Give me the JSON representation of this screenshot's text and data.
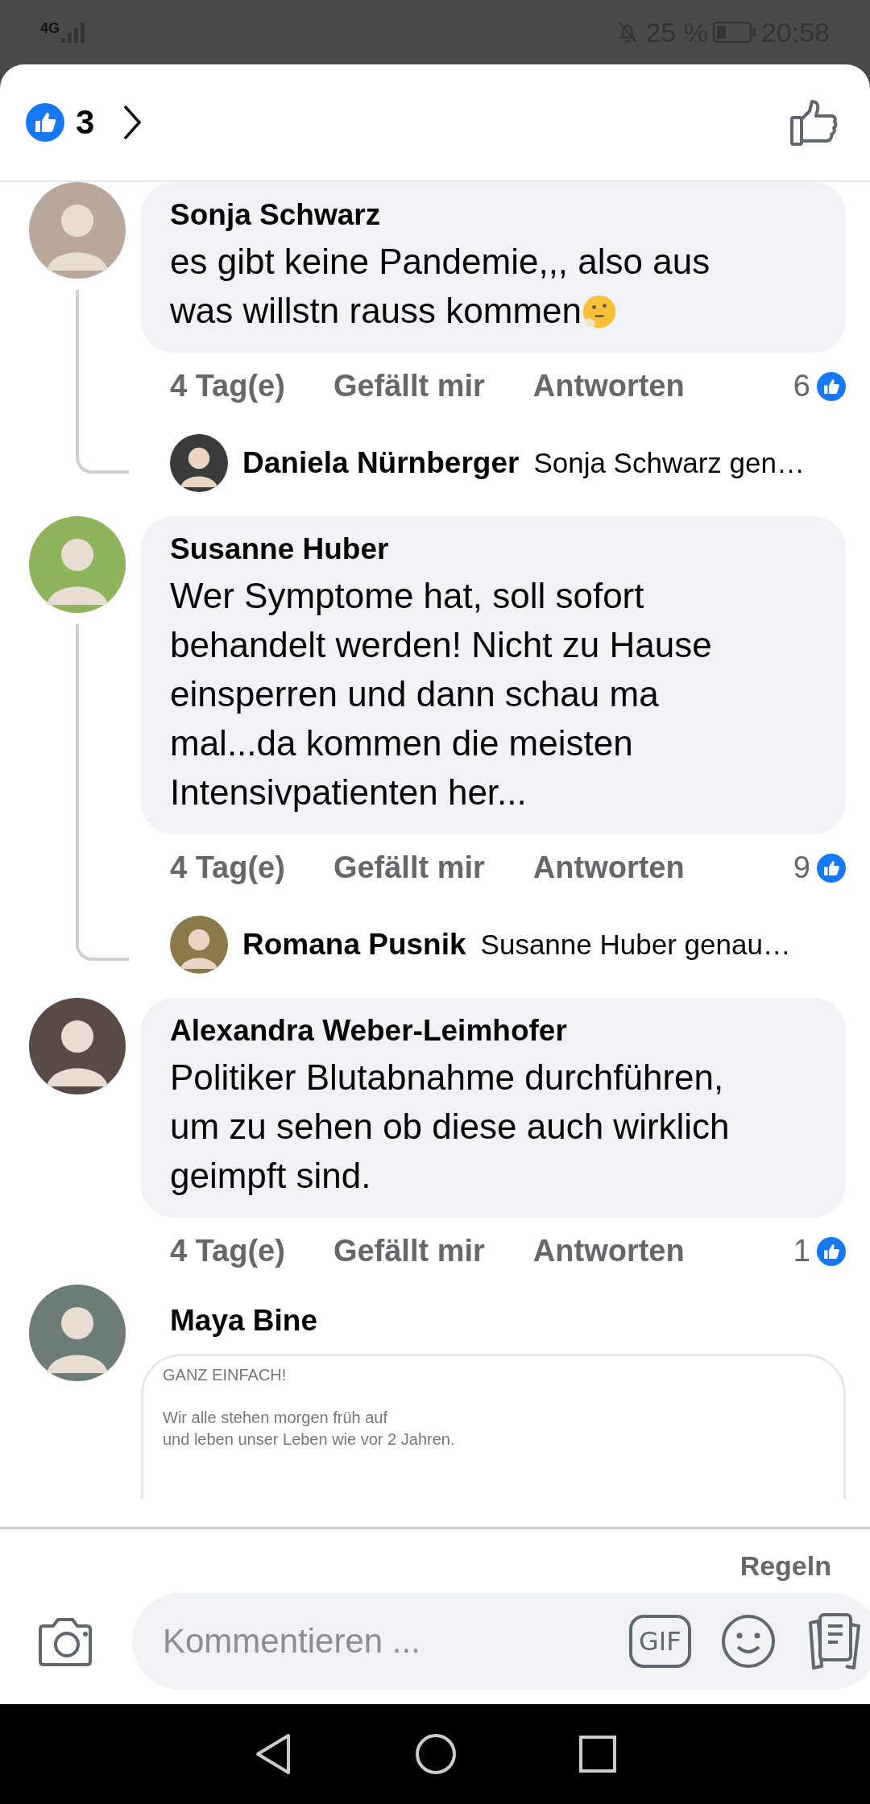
{
  "status_bar": {
    "network": "4G",
    "battery": "25 %",
    "time": "20:58"
  },
  "header": {
    "reaction_count": "3"
  },
  "comments": [
    {
      "name": "Sonja Schwarz",
      "text": "es gibt keine Pandemie,,, also aus was willstn rauss kommen",
      "time": "4 Tag(e)",
      "like_label": "Gefällt mir",
      "reply_label": "Antworten",
      "likes": "6",
      "reply": {
        "name": "Daniela Nürnberger",
        "text": "Sonja Schwarz gen…"
      }
    },
    {
      "name": "Susanne Huber",
      "text": "Wer Symptome hat, soll sofort behandelt werden! Nicht zu Hause einsperren und dann schau ma mal...da kommen die meisten Intensivpatienten her...",
      "time": "4 Tag(e)",
      "like_label": "Gefällt mir",
      "reply_label": "Antworten",
      "likes": "9",
      "reply": {
        "name": "Romana Pusnik",
        "text": "Susanne Huber genau…"
      }
    },
    {
      "name": "Alexandra Weber-Leimhofer",
      "text": "Politiker Blutabnahme durchführen, um zu sehen ob diese auch wirklich geimpft sind.",
      "time": "4 Tag(e)",
      "like_label": "Gefällt mir",
      "reply_label": "Antworten",
      "likes": "1"
    },
    {
      "name": "Maya Bine",
      "attachment": {
        "headline": "GANZ EINFACH!",
        "body": "Wir alle stehen morgen früh auf\nund leben unser Leben wie vor 2 Jahren."
      }
    }
  ],
  "footer": {
    "rules_link": "Regeln",
    "comment_placeholder": "Kommentieren ...",
    "gif_label": "GIF"
  }
}
